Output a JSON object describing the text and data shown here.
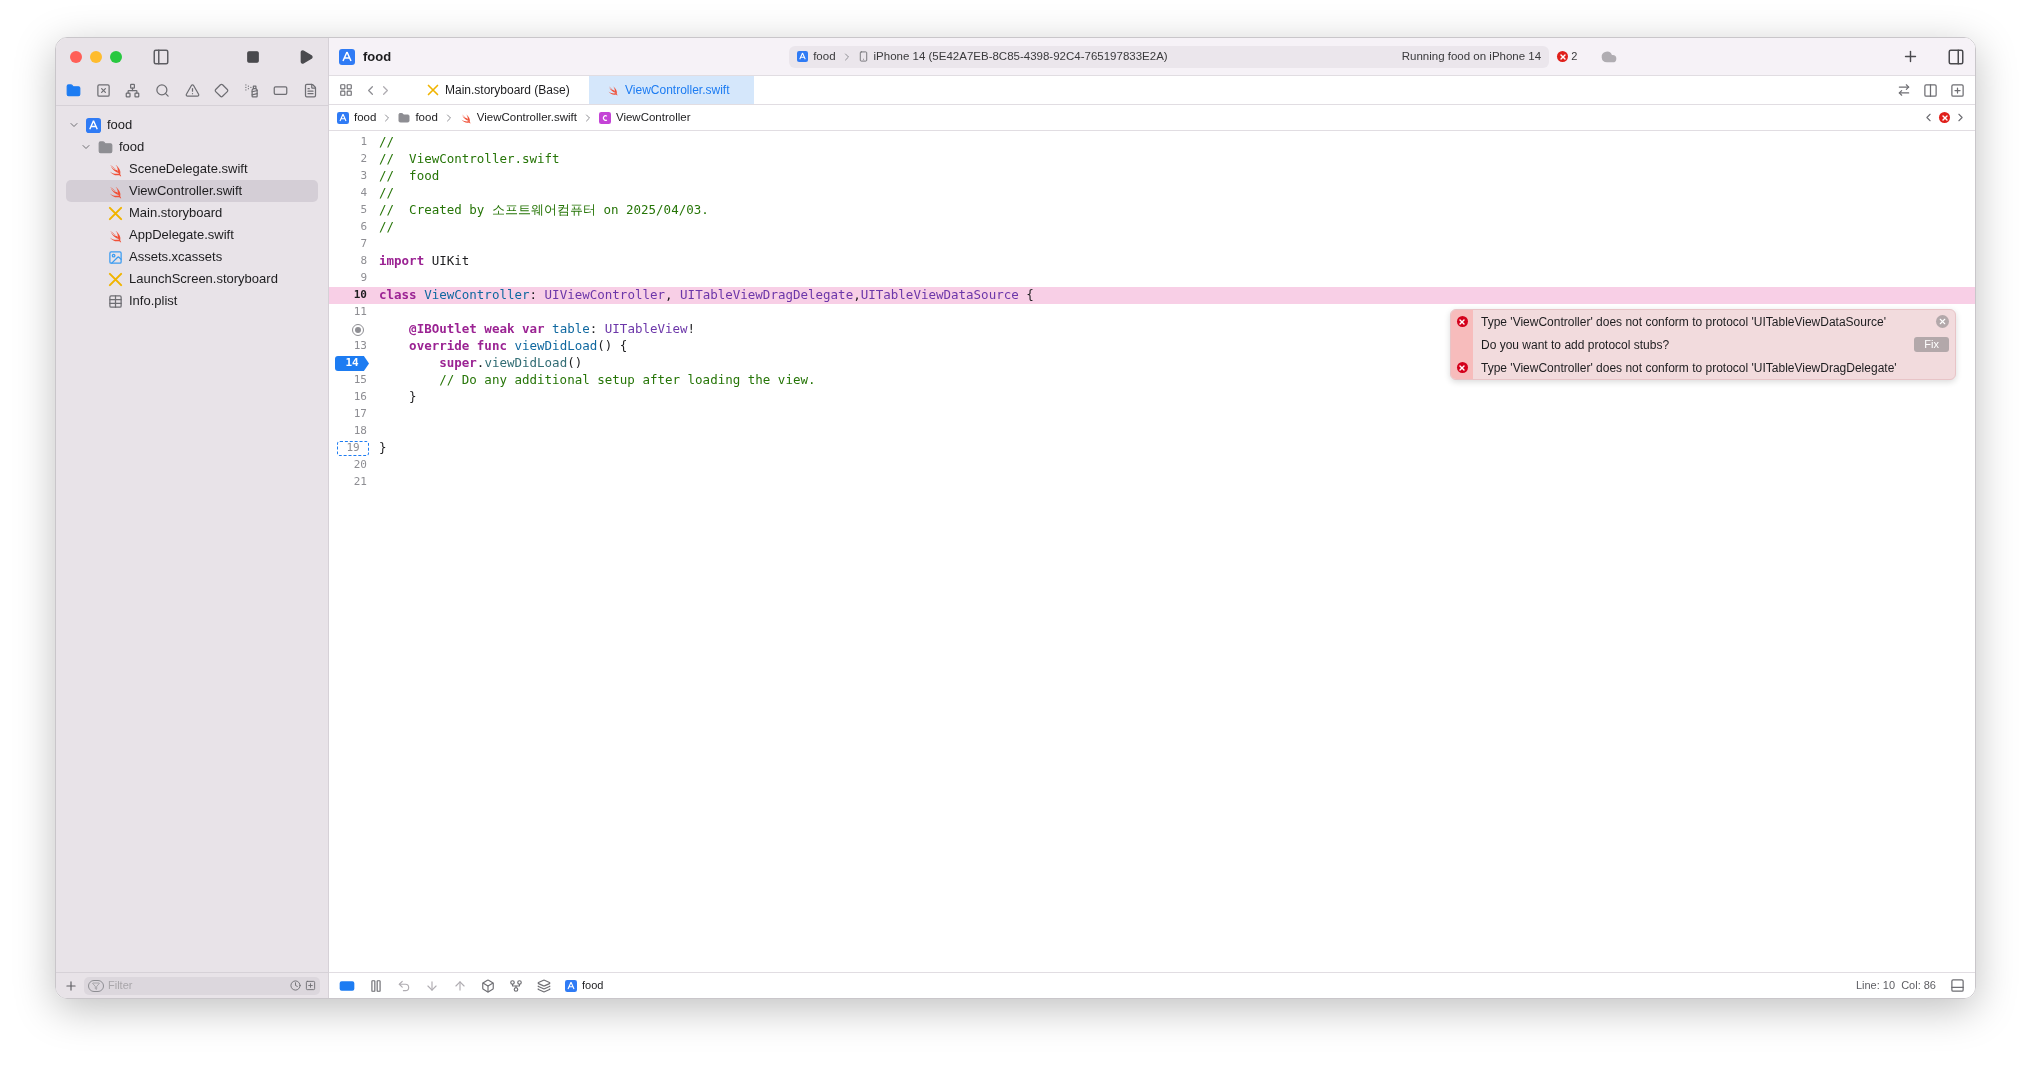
{
  "toolbar": {
    "project": "food",
    "scheme": "food",
    "device": "iPhone 14 (5E42A7EB-8C85-4398-92C4-765197833E2A)",
    "status": "Running food on iPhone 14",
    "error_count": "2"
  },
  "tabs": [
    {
      "label": "Main.storyboard (Base)",
      "kind": "storyboard",
      "selected": false
    },
    {
      "label": "ViewController.swift",
      "kind": "swift",
      "selected": true
    }
  ],
  "breadcrumb": [
    {
      "label": "food",
      "kind": "project"
    },
    {
      "label": "food",
      "kind": "folder"
    },
    {
      "label": "ViewController.swift",
      "kind": "swift"
    },
    {
      "label": "ViewController",
      "kind": "class"
    }
  ],
  "navigator": {
    "label": "food",
    "kind": "project",
    "expanded": true,
    "children": [
      {
        "label": "food",
        "kind": "folder",
        "expanded": true,
        "children": [
          {
            "label": "SceneDelegate.swift",
            "kind": "swift",
            "selected": false
          },
          {
            "label": "ViewController.swift",
            "kind": "swift",
            "selected": true
          },
          {
            "label": "Main.storyboard",
            "kind": "storyboard",
            "selected": false
          },
          {
            "label": "AppDelegate.swift",
            "kind": "swift",
            "selected": false
          },
          {
            "label": "Assets.xcassets",
            "kind": "assets",
            "selected": false
          },
          {
            "label": "LaunchScreen.storyboard",
            "kind": "storyboard",
            "selected": false
          },
          {
            "label": "Info.plist",
            "kind": "plist",
            "selected": false
          }
        ]
      }
    ]
  },
  "filter": {
    "placeholder": "Filter"
  },
  "lines": [
    {
      "kind": "numbered",
      "number": "1",
      "error": false,
      "tokens": [
        {
          "text": "//",
          "kind": "comment"
        }
      ]
    },
    {
      "kind": "numbered",
      "number": "2",
      "error": false,
      "tokens": [
        {
          "text": "//  ViewController.swift",
          "kind": "comment"
        }
      ]
    },
    {
      "kind": "numbered",
      "number": "3",
      "error": false,
      "tokens": [
        {
          "text": "//  food",
          "kind": "comment"
        }
      ]
    },
    {
      "kind": "numbered",
      "number": "4",
      "error": false,
      "tokens": [
        {
          "text": "//",
          "kind": "comment"
        }
      ]
    },
    {
      "kind": "numbered",
      "number": "5",
      "error": false,
      "tokens": [
        {
          "text": "//  Created by 소프트웨어컴퓨터 on 2025/04/03.",
          "kind": "comment"
        }
      ]
    },
    {
      "kind": "numbered",
      "number": "6",
      "error": false,
      "tokens": [
        {
          "text": "//",
          "kind": "comment"
        }
      ]
    },
    {
      "kind": "numbered",
      "number": "7",
      "error": false
    },
    {
      "kind": "numbered",
      "number": "8",
      "error": false,
      "tokens": [
        {
          "text": "import",
          "kind": "keyword"
        },
        {
          "text": " UIKit",
          "kind": "plain"
        }
      ]
    },
    {
      "kind": "numbered",
      "number": "9",
      "error": false
    },
    {
      "kind": "numbered",
      "number": "10",
      "error": true,
      "tokens": [
        {
          "text": "class",
          "kind": "keyword"
        },
        {
          "text": " ViewController",
          "kind": "decl"
        },
        {
          "text": ": ",
          "kind": "plain"
        },
        {
          "text": "UIViewController",
          "kind": "type"
        },
        {
          "text": ", ",
          "kind": "plain"
        },
        {
          "text": "UITableViewDragDelegate",
          "kind": "type"
        },
        {
          "text": ",",
          "kind": "plain"
        },
        {
          "text": "UITableViewDataSource",
          "kind": "type"
        },
        {
          "text": " {",
          "kind": "plain"
        }
      ]
    },
    {
      "kind": "numbered",
      "number": "11",
      "error": false
    },
    {
      "kind": "outlet",
      "error": false,
      "tokens": [
        {
          "text": "    @IBOutlet",
          "kind": "keyword"
        },
        {
          "text": " weak",
          "kind": "keyword"
        },
        {
          "text": " var",
          "kind": "keyword"
        },
        {
          "text": " table",
          "kind": "decl"
        },
        {
          "text": ": ",
          "kind": "plain"
        },
        {
          "text": "UITableView",
          "kind": "type"
        },
        {
          "text": "!",
          "kind": "plain"
        }
      ]
    },
    {
      "kind": "numbered",
      "number": "13",
      "error": false,
      "tokens": [
        {
          "text": "    override",
          "kind": "keyword"
        },
        {
          "text": " func",
          "kind": "keyword"
        },
        {
          "text": " viewDidLoad",
          "kind": "decl"
        },
        {
          "text": "() {",
          "kind": "plain"
        }
      ]
    },
    {
      "kind": "numbered",
      "number": "14",
      "error": false,
      "breakpoint_enabled": true,
      "tokens": [
        {
          "text": "        super",
          "kind": "keyword"
        },
        {
          "text": ".",
          "kind": "plain"
        },
        {
          "text": "viewDidLoad",
          "kind": "call"
        },
        {
          "text": "()",
          "kind": "plain"
        }
      ]
    },
    {
      "kind": "numbered",
      "number": "15",
      "error": false,
      "tokens": [
        {
          "text": "        // Do any additional setup after loading the view.",
          "kind": "comment"
        }
      ]
    },
    {
      "kind": "numbered",
      "number": "16",
      "error": false,
      "tokens": [
        {
          "text": "    }",
          "kind": "plain"
        }
      ]
    },
    {
      "kind": "numbered",
      "number": "17",
      "error": false
    },
    {
      "kind": "numbered",
      "number": "18",
      "error": false
    },
    {
      "kind": "numbered",
      "number": "19",
      "error": false,
      "breakpoint_enabled": false,
      "tokens": [
        {
          "text": "}",
          "kind": "plain"
        }
      ]
    },
    {
      "kind": "numbered",
      "number": "20",
      "error": false
    },
    {
      "kind": "numbered",
      "number": "21",
      "error": false
    }
  ],
  "issues": [
    {
      "kind": "error",
      "text": "Type 'ViewController' does not conform to protocol 'UITableViewDataSource'"
    },
    {
      "kind": "fix",
      "text": "Do you want to add protocol stubs?",
      "button": "Fix"
    },
    {
      "kind": "error",
      "text": "Type 'ViewController' does not conform to protocol 'UITableViewDragDelegate'"
    }
  ],
  "debug_bar": {
    "target": "food"
  },
  "status_bar": {
    "position": "Line: 10  Col: 86"
  }
}
